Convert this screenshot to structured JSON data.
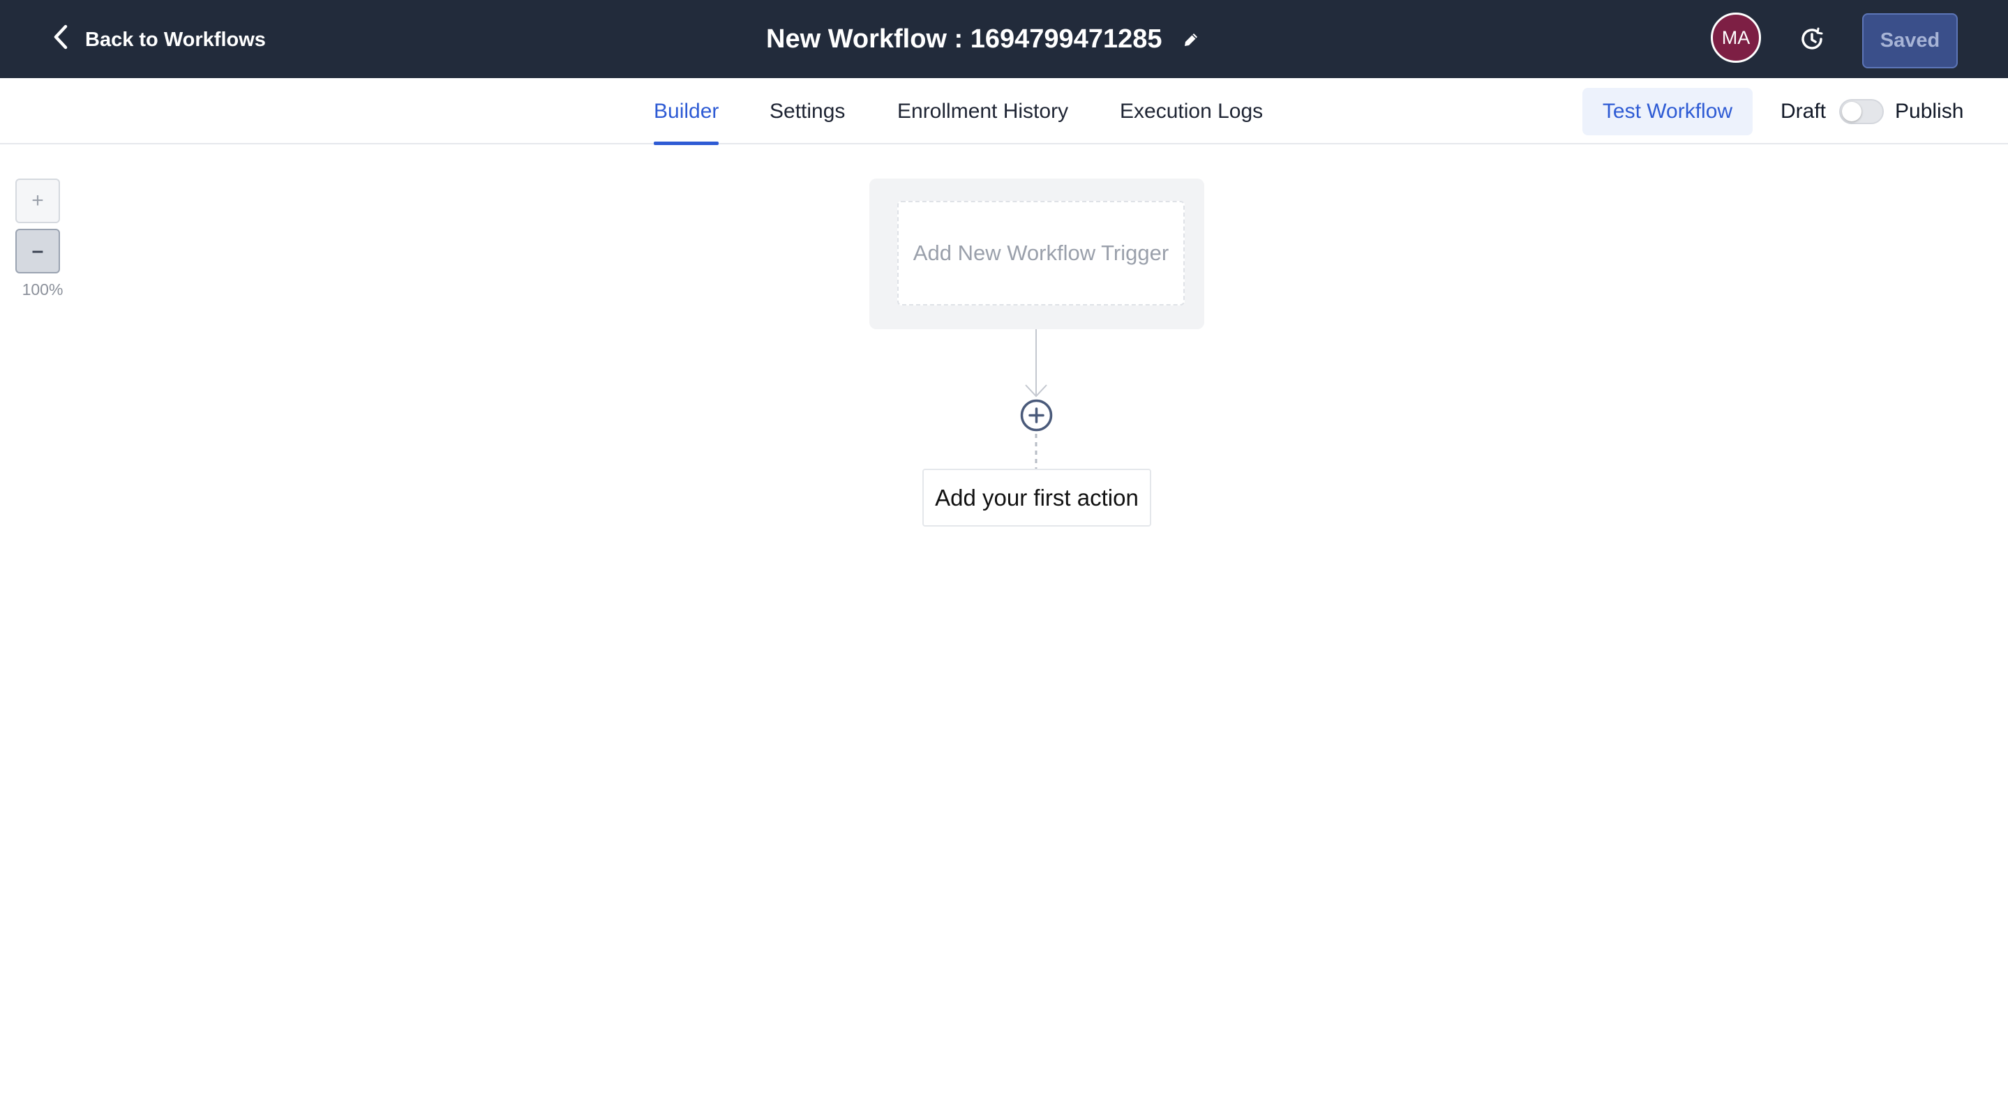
{
  "header": {
    "back_label": "Back to Workflows",
    "title": "New Workflow : 1694799471285",
    "avatar_initials": "MA",
    "saved_label": "Saved",
    "colors": {
      "bar_bg": "#222b3b",
      "avatar_bg": "#7d1f44",
      "saved_bg": "#3a4f8a"
    }
  },
  "tabs": [
    {
      "label": "Builder",
      "active": true
    },
    {
      "label": "Settings",
      "active": false
    },
    {
      "label": "Enrollment History",
      "active": false
    },
    {
      "label": "Execution Logs",
      "active": false
    }
  ],
  "actions": {
    "test_label": "Test Workflow",
    "draft_label": "Draft",
    "publish_label": "Publish",
    "published": false
  },
  "zoom": {
    "in_label": "+",
    "out_label": "–",
    "level": "100%"
  },
  "canvas": {
    "trigger_label": "Add New Workflow Trigger",
    "first_action_label": "Add your first action"
  },
  "icons": {
    "back": "chevron-left-icon",
    "edit": "pencil-icon",
    "history": "history-clock-icon",
    "add": "plus-circle-icon"
  },
  "accent_color": "#2e5bd4"
}
